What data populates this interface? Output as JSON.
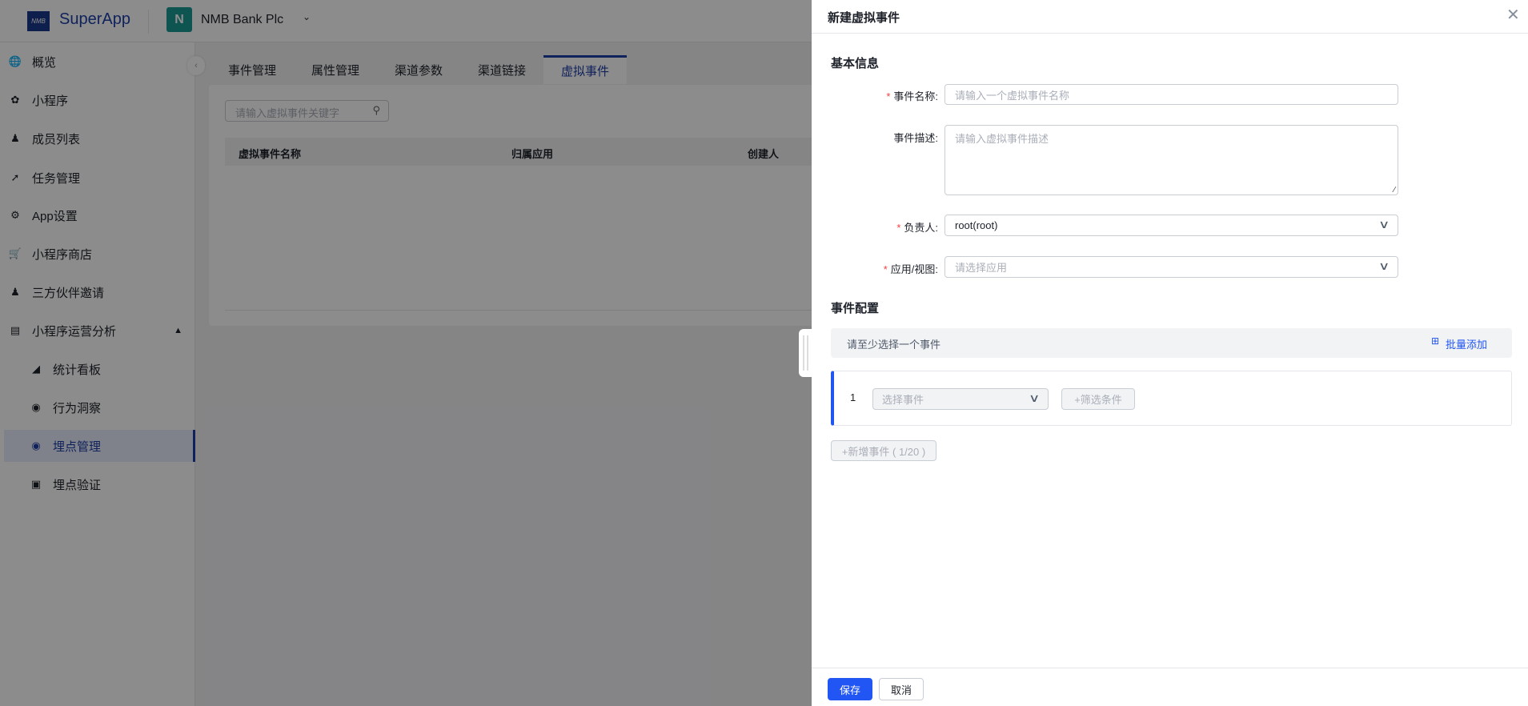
{
  "header": {
    "logo_text": "NMB",
    "brand": "SuperApp",
    "org_initial": "N",
    "org_name": "NMB Bank Plc"
  },
  "sidebar": {
    "items": [
      {
        "label": "概览",
        "icon": "globe-icon"
      },
      {
        "label": "小程序",
        "icon": "aperture-icon"
      },
      {
        "label": "成员列表",
        "icon": "user-add-icon"
      },
      {
        "label": "任务管理",
        "icon": "tasks-icon"
      },
      {
        "label": "App设置",
        "icon": "gear-icon"
      },
      {
        "label": "小程序商店",
        "icon": "cart-icon"
      },
      {
        "label": "三方伙伴邀请",
        "icon": "users-icon"
      },
      {
        "label": "小程序运营分析",
        "icon": "bar-chart-icon"
      },
      {
        "label": "统计看板",
        "icon": "area-chart-icon"
      },
      {
        "label": "行为洞察",
        "icon": "eye-icon"
      },
      {
        "label": "埋点管理",
        "icon": "target-icon"
      },
      {
        "label": "埋点验证",
        "icon": "verify-icon"
      }
    ]
  },
  "tabs": [
    "事件管理",
    "属性管理",
    "渠道参数",
    "渠道链接",
    "虚拟事件"
  ],
  "search_placeholder": "请输入虚拟事件关键字",
  "table": {
    "columns": [
      "虚拟事件名称",
      "归属应用",
      "创建人"
    ]
  },
  "drawer": {
    "title": "新建虚拟事件",
    "basic_title": "基本信息",
    "name_label": "事件名称:",
    "name_placeholder": "请输入一个虚拟事件名称",
    "desc_label": "事件描述:",
    "desc_placeholder": "请输入虚拟事件描述",
    "owner_label": "负责人:",
    "owner_value": "root(root)",
    "app_label": "应用/视图:",
    "app_placeholder": "请选择应用",
    "config_title": "事件配置",
    "hint": "请至少选择一个事件",
    "batch_add": "批量添加",
    "event_index": "1",
    "event_select_placeholder": "选择事件",
    "filter_button": "+筛选条件",
    "add_event": "+新增事件 ( 1/20 )",
    "save": "保存",
    "cancel": "取消"
  },
  "colors": {
    "primary": "#2155f4",
    "brand": "#1e3fa8",
    "required": "#f53f3f"
  }
}
